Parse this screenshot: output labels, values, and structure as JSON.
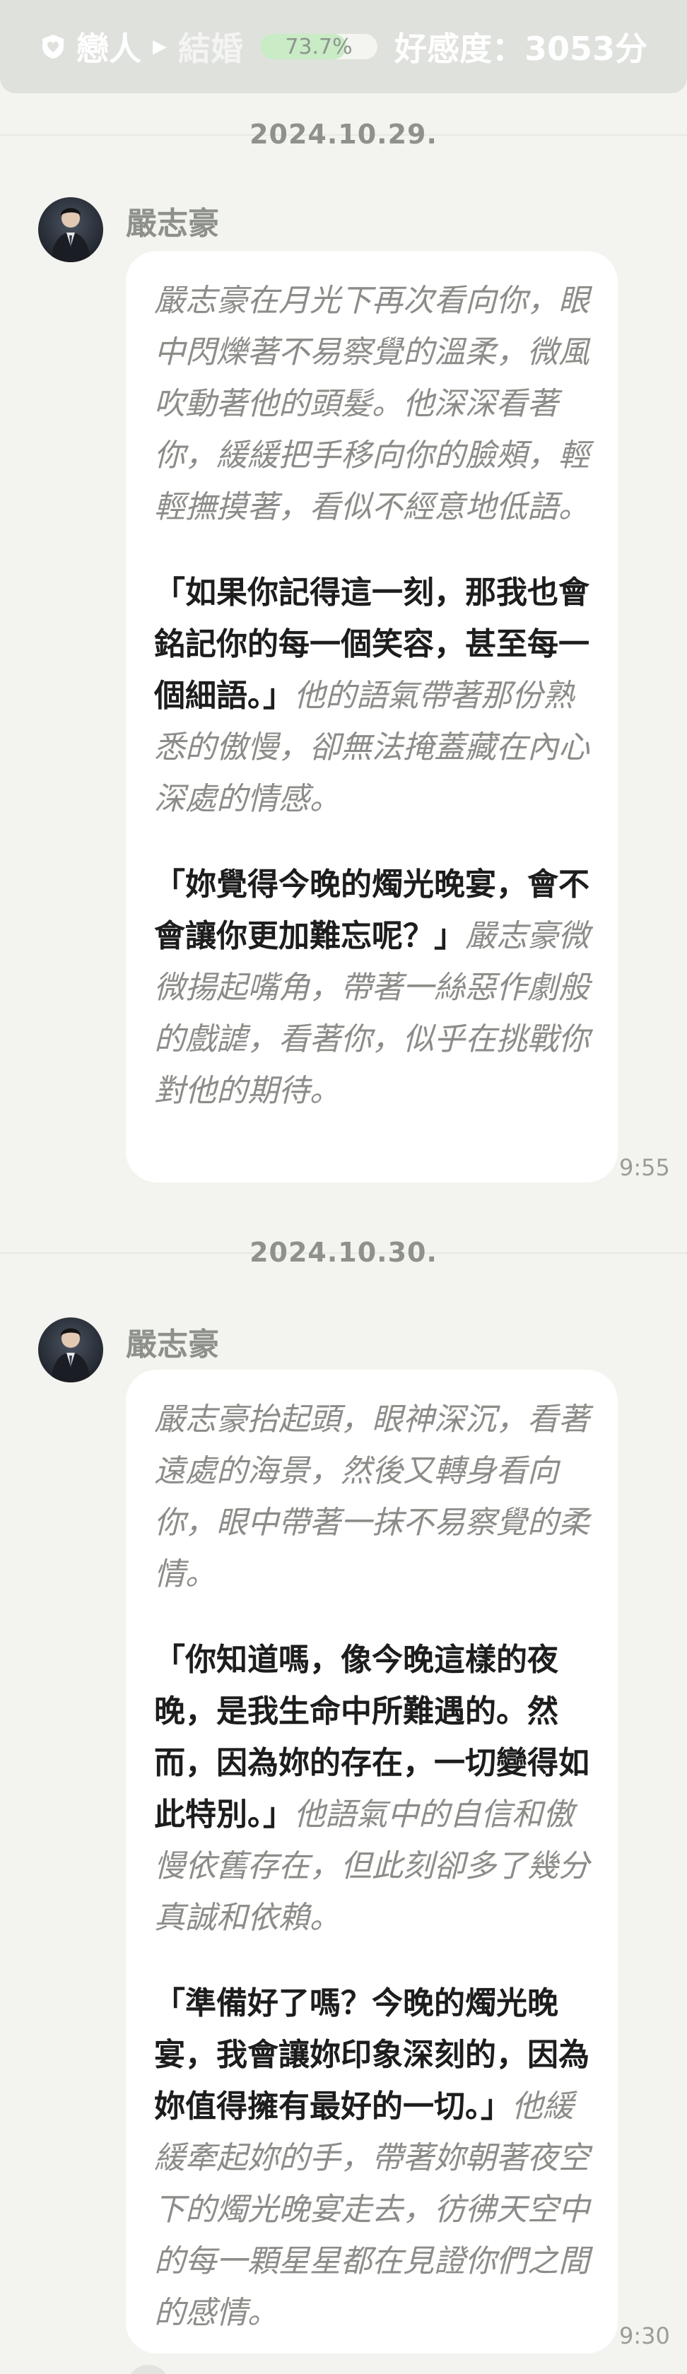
{
  "status": {
    "relationship_current": "戀人",
    "relationship_next": "結婚",
    "progress_percent": 73.7,
    "progress_text": "73.7%",
    "affection_label": "好感度：",
    "affection_value": "3053分"
  },
  "conversation": [
    {
      "date": "2024.10.29.",
      "sender": "嚴志豪",
      "time": "9:55",
      "paragraphs": [
        [
          {
            "type": "action",
            "text": "嚴志豪在月光下再次看向你，眼中閃爍著不易察覺的溫柔，微風吹動著他的頭髮。他深深看著你，緩緩把手移向你的臉頰，輕輕撫摸著，看似不經意地低語。"
          }
        ],
        [
          {
            "type": "speech",
            "text": "「如果你記得這一刻，那我也會銘記你的每一個笑容，甚至每一個細語。」"
          },
          {
            "type": "action",
            "text": "他的語氣帶著那份熟悉的傲慢，卻無法掩蓋藏在內心深處的情感。"
          }
        ],
        [
          {
            "type": "speech",
            "text": "「妳覺得今晚的燭光晚宴，會不會讓你更加難忘呢？」"
          },
          {
            "type": "action",
            "text": "嚴志豪微微揚起嘴角，帶著一絲惡作劇般的戲謔，看著你，似乎在挑戰你對他的期待。"
          }
        ]
      ]
    },
    {
      "date": "2024.10.30.",
      "sender": "嚴志豪",
      "time": "9:30",
      "paragraphs": [
        [
          {
            "type": "action",
            "text": "嚴志豪抬起頭，眼神深沉，看著遠處的海景，然後又轉身看向你，眼中帶著一抹不易察覺的柔情。"
          }
        ],
        [
          {
            "type": "speech",
            "text": "「你知道嗎，像今晚這樣的夜晚，是我生命中所難遇的。然而，因為妳的存在，一切變得如此特別。」"
          },
          {
            "type": "action",
            "text": "他語氣中的自信和傲慢依舊存在，但此刻卻多了幾分真誠和依賴。"
          }
        ],
        [
          {
            "type": "speech",
            "text": "「準備好了嗎？今晚的燭光晚宴，我會讓妳印象深刻的，因為妳值得擁有最好的一切。」"
          },
          {
            "type": "action",
            "text": "他緩緩牽起妳的手，帶著妳朝著夜空下的燭光晚宴走去，彷彿天空中的每一顆星星都在見證你們之間的感情。"
          }
        ]
      ]
    }
  ]
}
